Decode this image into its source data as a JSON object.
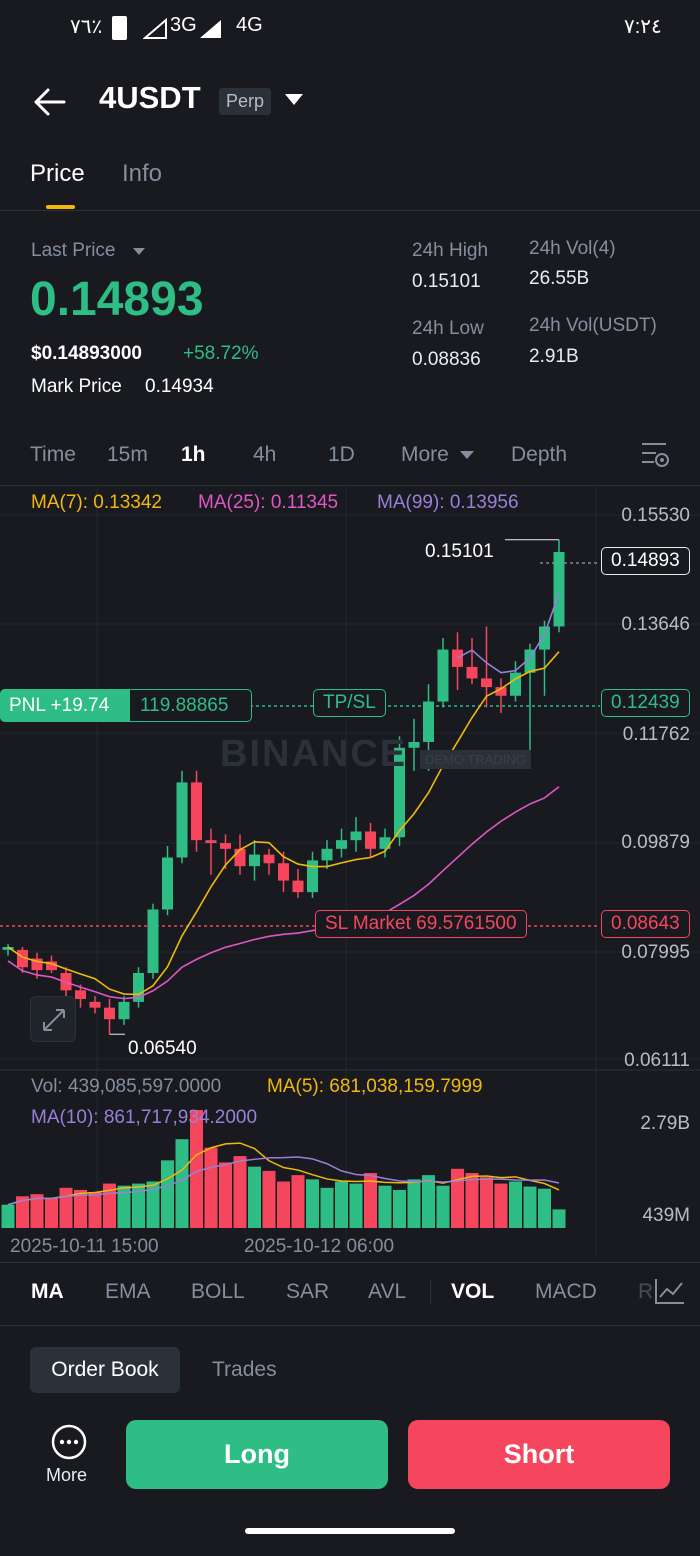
{
  "status_bar": {
    "battery": "٧٦٪",
    "net1": "3G",
    "net2": "4G",
    "time": "٧:٢٤"
  },
  "header": {
    "symbol": "4USDT",
    "badge": "Perp"
  },
  "tabs": [
    {
      "label": "Price",
      "active": true
    },
    {
      "label": "Info",
      "active": false
    }
  ],
  "price": {
    "last_price_label": "Last Price",
    "last_price": "0.14893",
    "usd_price": "$0.14893000",
    "change": "+58.72%",
    "mark_price_label": "Mark Price",
    "mark_price": "0.14934",
    "high_label": "24h High",
    "high": "0.15101",
    "low_label": "24h Low",
    "low": "0.08836",
    "vol_base_label": "24h Vol(4)",
    "vol_base": "26.55B",
    "vol_quote_label": "24h Vol(USDT)",
    "vol_quote": "2.91B"
  },
  "timeframes": {
    "time": "Time",
    "m15": "15m",
    "h1": "1h",
    "h4": "4h",
    "d1": "1D",
    "more": "More",
    "depth": "Depth"
  },
  "chart": {
    "ma7": "MA(7): 0.13342",
    "ma25": "MA(25): 0.11345",
    "ma99": "MA(99): 0.13956",
    "watermark": "BINANCE",
    "watermark_sub": "DEMO TRADING",
    "y_labels": [
      "0.15530",
      "0.13646",
      "0.11762",
      "0.09879",
      "0.07995",
      "0.06111"
    ],
    "current_price_tag": "0.14893",
    "high_marker": "0.15101",
    "low_marker": "0.06540",
    "pnl_label": "PNL +19.74",
    "entry_price": "119.88865",
    "tpsl_label": "TP/SL",
    "entry_tag": "0.12439",
    "sl_label": "SL Market  69.5761500",
    "sl_tag": "0.08643",
    "vol_label": "Vol: 439,085,597.0000",
    "vol_ma5": "MA(5): 681,038,159.7999",
    "vol_ma10": "MA(10): 861,717,934.2000",
    "vol_y_top": "2.79B",
    "vol_y_bottom": "439M",
    "x_label_1": "2025-10-11 15:00",
    "x_label_2": "2025-10-12 06:00"
  },
  "indicators": {
    "ma": "MA",
    "ema": "EMA",
    "boll": "BOLL",
    "sar": "SAR",
    "avl": "AVL",
    "vol": "VOL",
    "macd": "MACD",
    "r": "R"
  },
  "bottom": {
    "order_book": "Order Book",
    "trades": "Trades",
    "more": "More",
    "long": "Long",
    "short": "Short"
  },
  "chart_data": {
    "type": "candlestick",
    "y_range": [
      0.06111,
      0.1553
    ],
    "candles": [
      {
        "o": 0.08,
        "h": 0.081,
        "l": 0.079,
        "c": 0.0805
      },
      {
        "o": 0.08,
        "h": 0.0805,
        "l": 0.076,
        "c": 0.077
      },
      {
        "o": 0.0785,
        "h": 0.0795,
        "l": 0.075,
        "c": 0.0765
      },
      {
        "o": 0.078,
        "h": 0.079,
        "l": 0.076,
        "c": 0.0765
      },
      {
        "o": 0.076,
        "h": 0.077,
        "l": 0.072,
        "c": 0.073
      },
      {
        "o": 0.073,
        "h": 0.074,
        "l": 0.07,
        "c": 0.0715
      },
      {
        "o": 0.071,
        "h": 0.072,
        "l": 0.069,
        "c": 0.07
      },
      {
        "o": 0.07,
        "h": 0.0715,
        "l": 0.0654,
        "c": 0.068
      },
      {
        "o": 0.068,
        "h": 0.072,
        "l": 0.067,
        "c": 0.071
      },
      {
        "o": 0.071,
        "h": 0.077,
        "l": 0.07,
        "c": 0.076
      },
      {
        "o": 0.076,
        "h": 0.088,
        "l": 0.075,
        "c": 0.087
      },
      {
        "o": 0.087,
        "h": 0.098,
        "l": 0.086,
        "c": 0.096
      },
      {
        "o": 0.096,
        "h": 0.111,
        "l": 0.095,
        "c": 0.109
      },
      {
        "o": 0.109,
        "h": 0.111,
        "l": 0.097,
        "c": 0.099
      },
      {
        "o": 0.099,
        "h": 0.101,
        "l": 0.093,
        "c": 0.0985
      },
      {
        "o": 0.0985,
        "h": 0.1,
        "l": 0.094,
        "c": 0.0975
      },
      {
        "o": 0.0975,
        "h": 0.1,
        "l": 0.093,
        "c": 0.0945
      },
      {
        "o": 0.0945,
        "h": 0.099,
        "l": 0.092,
        "c": 0.0965
      },
      {
        "o": 0.0965,
        "h": 0.0975,
        "l": 0.093,
        "c": 0.095
      },
      {
        "o": 0.095,
        "h": 0.097,
        "l": 0.09,
        "c": 0.092
      },
      {
        "o": 0.092,
        "h": 0.094,
        "l": 0.089,
        "c": 0.09
      },
      {
        "o": 0.09,
        "h": 0.097,
        "l": 0.089,
        "c": 0.0955
      },
      {
        "o": 0.0955,
        "h": 0.099,
        "l": 0.094,
        "c": 0.0975
      },
      {
        "o": 0.0975,
        "h": 0.101,
        "l": 0.096,
        "c": 0.099
      },
      {
        "o": 0.099,
        "h": 0.103,
        "l": 0.097,
        "c": 0.1005
      },
      {
        "o": 0.1005,
        "h": 0.102,
        "l": 0.096,
        "c": 0.0975
      },
      {
        "o": 0.0975,
        "h": 0.101,
        "l": 0.096,
        "c": 0.0995
      },
      {
        "o": 0.0995,
        "h": 0.117,
        "l": 0.098,
        "c": 0.115
      },
      {
        "o": 0.115,
        "h": 0.12,
        "l": 0.111,
        "c": 0.116
      },
      {
        "o": 0.116,
        "h": 0.126,
        "l": 0.111,
        "c": 0.123
      },
      {
        "o": 0.123,
        "h": 0.134,
        "l": 0.122,
        "c": 0.132
      },
      {
        "o": 0.132,
        "h": 0.135,
        "l": 0.125,
        "c": 0.129
      },
      {
        "o": 0.129,
        "h": 0.134,
        "l": 0.126,
        "c": 0.127
      },
      {
        "o": 0.127,
        "h": 0.136,
        "l": 0.122,
        "c": 0.1255
      },
      {
        "o": 0.1255,
        "h": 0.127,
        "l": 0.121,
        "c": 0.124
      },
      {
        "o": 0.124,
        "h": 0.13,
        "l": 0.123,
        "c": 0.128
      },
      {
        "o": 0.128,
        "h": 0.133,
        "l": 0.112,
        "c": 0.132
      },
      {
        "o": 0.132,
        "h": 0.137,
        "l": 0.124,
        "c": 0.136
      },
      {
        "o": 0.136,
        "h": 0.151,
        "l": 0.135,
        "c": 0.1489
      }
    ],
    "volume": [
      0.55,
      0.75,
      0.8,
      0.7,
      0.95,
      0.9,
      0.85,
      1.05,
      1.0,
      1.05,
      1.1,
      1.6,
      2.1,
      2.79,
      1.9,
      1.55,
      1.7,
      1.45,
      1.35,
      1.1,
      1.25,
      1.15,
      0.95,
      1.1,
      1.05,
      1.3,
      1.0,
      0.9,
      1.15,
      1.25,
      1.0,
      1.4,
      1.3,
      1.2,
      1.05,
      1.1,
      0.98,
      0.93,
      0.44
    ]
  }
}
